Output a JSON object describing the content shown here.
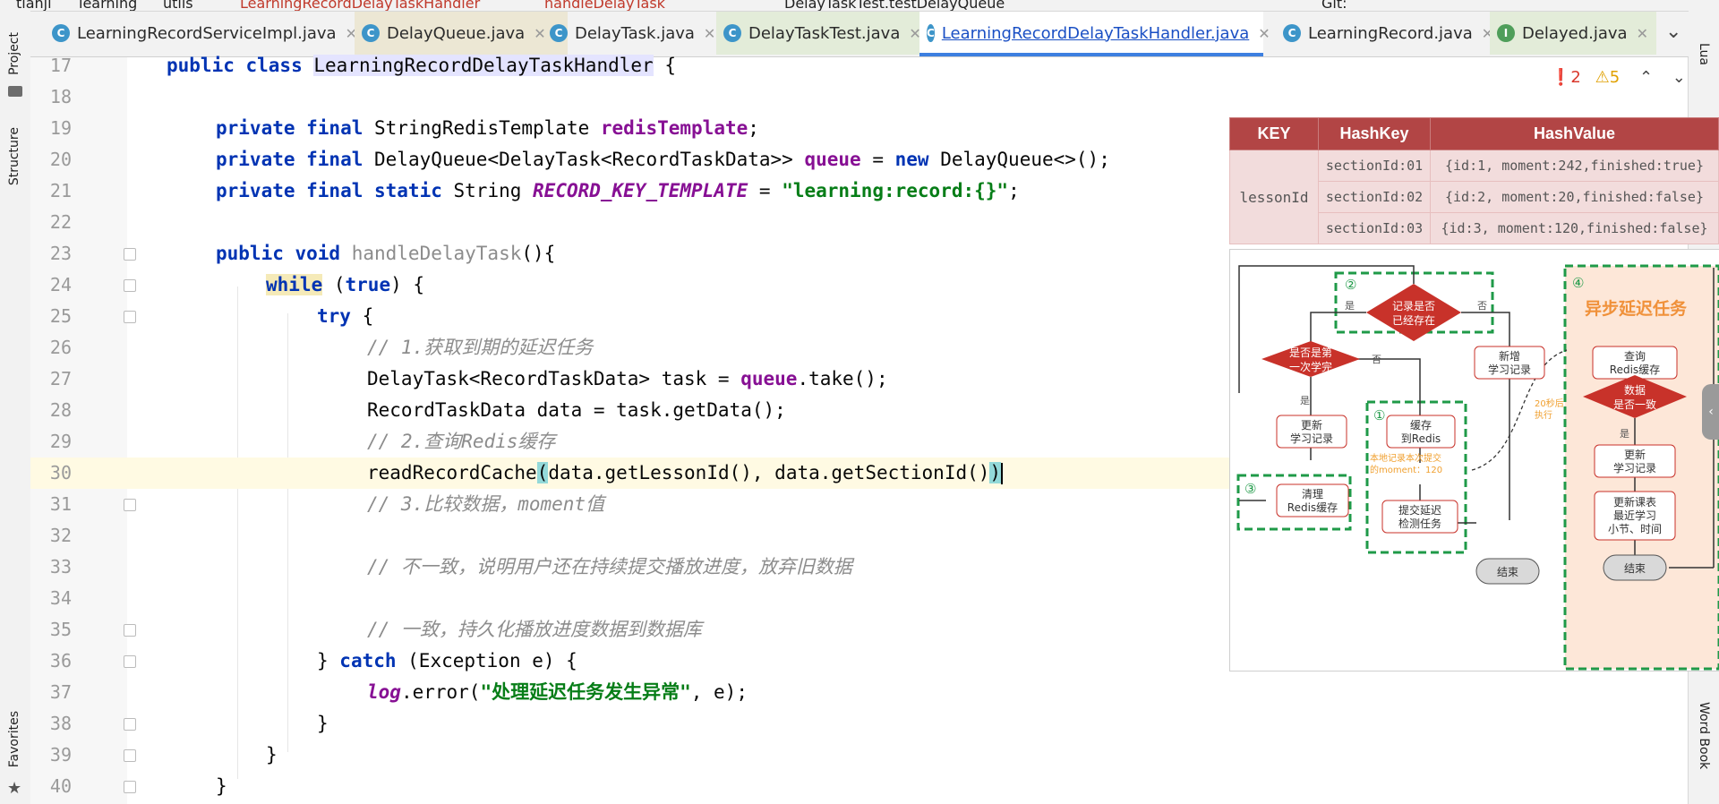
{
  "breadcrumb": [
    "tianji",
    "learning",
    "utils",
    "LearningRecordDelayTaskHandler",
    "handleDelayTask"
  ],
  "run_config": "DelayTaskTest.testDelayQueue",
  "git_label": "Git:",
  "sidebar_left": {
    "project": "Project",
    "structure": "Structure",
    "favorites": "Favorites"
  },
  "sidebar_right": {
    "top": "Lua",
    "word_book": "Word Book"
  },
  "tabs": [
    {
      "label": "LearningRecordServiceImpl.java",
      "icon": "C"
    },
    {
      "label": "DelayQueue.java",
      "icon": "C"
    },
    {
      "label": "DelayTask.java",
      "icon": "C"
    },
    {
      "label": "DelayTaskTest.java",
      "icon": "C"
    },
    {
      "label": "LearningRecordDelayTaskHandler.java",
      "icon": "C"
    },
    {
      "label": "LearningRecord.java",
      "icon": "C"
    },
    {
      "label": "Delayed.java",
      "icon": "I"
    }
  ],
  "inspections": {
    "errors": "2",
    "warnings": "5"
  },
  "line_numbers": [
    "17",
    "18",
    "19",
    "20",
    "21",
    "22",
    "23",
    "24",
    "25",
    "26",
    "27",
    "28",
    "29",
    "30",
    "31",
    "32",
    "33",
    "34",
    "35",
    "36",
    "37",
    "38",
    "39",
    "40"
  ],
  "code": {
    "l17": {
      "kw": "public class ",
      "cls": "LearningRecordDelayTaskHandler",
      "rest": " {"
    },
    "l19": {
      "kw": "private final ",
      "type": "StringRedisTemplate ",
      "field": "redisTemplate",
      "rest": ";"
    },
    "l20": {
      "kw": "private final ",
      "type": "DelayQueue<DelayTask<RecordTaskData>> ",
      "field": "queue",
      "eq": " = ",
      "kw2": "new ",
      "rest": "DelayQueue<>();"
    },
    "l21": {
      "kw": "private final static ",
      "type": "String ",
      "const": "RECORD_KEY_TEMPLATE",
      "eq": " = ",
      "str": "\"learning:record:{}\"",
      "rest": ";"
    },
    "l23": {
      "kw": "public void ",
      "method": "handleDelayTask",
      "rest": "(){"
    },
    "l24": {
      "kw": "while",
      "p1": " (",
      "kw2": "true",
      "p2": ") {"
    },
    "l25": {
      "kw": "try",
      "rest": " {"
    },
    "l26": "// 1.获取到期的延迟任务",
    "l27": {
      "a": "DelayTask<RecordTaskData> task = ",
      "field": "queue",
      "b": ".take();"
    },
    "l28": "RecordTaskData data = task.getData();",
    "l29": "// 2.查询Redis缓存",
    "l30": {
      "a": "readRecordCache",
      "b": "(",
      "c": "data.getLessonId(), data.getSectionId()",
      "d": ")"
    },
    "l31": "// 3.比较数据，moment值",
    "l33": "// 不一致，说明用户还在持续提交播放进度，放弃旧数据",
    "l35": "// 一致，持久化播放进度数据到数据库",
    "l36": {
      "a": "} ",
      "kw": "catch",
      "b": " (Exception e) {"
    },
    "l37": {
      "field": "log",
      "a": ".error(",
      "str": "\"处理延迟任务发生异常\"",
      "b": ", e);"
    },
    "l38": "}",
    "l39": "}",
    "l40": "}"
  },
  "redis_table": {
    "headers": [
      "KEY",
      "HashKey",
      "HashValue"
    ],
    "key": "lessonId",
    "rows": [
      {
        "hashkey": "sectionId:01",
        "value": "{id:1, moment:242,finished:true}"
      },
      {
        "hashkey": "sectionId:02",
        "value": "{id:2, moment:20,finished:false}"
      },
      {
        "hashkey": "sectionId:03",
        "value": "{id:3, moment:120,finished:false}"
      }
    ]
  },
  "flowchart": {
    "async_title": "异步延迟任务",
    "num1": "①",
    "num2": "②",
    "num3": "③",
    "num4": "④",
    "d1": [
      "记录是否",
      "已经存在"
    ],
    "d2": [
      "是否是第",
      "一次学完"
    ],
    "d3": [
      "数据",
      "是否一致"
    ],
    "yes": "是",
    "no": "否",
    "new_record": [
      "新增",
      "学习记录"
    ],
    "update_record": [
      "更新",
      "学习记录"
    ],
    "cache_redis": [
      "缓存",
      "到Redis"
    ],
    "clear_redis": [
      "清理",
      "Redis缓存"
    ],
    "submit_task": [
      "提交延迟",
      "检测任务"
    ],
    "local_note": [
      "本地记录本次提交",
      "的moment：120"
    ],
    "query_redis": [
      "查询",
      "Redis缓存"
    ],
    "update_record2": [
      "更新",
      "学习记录"
    ],
    "update_course": [
      "更新课表",
      "最近学习",
      "小节、时间"
    ],
    "end": "结束",
    "delay_note": [
      "20秒后",
      "执行"
    ]
  },
  "colors": {
    "keyword": "#0033b3",
    "field": "#871094",
    "string": "#067d17",
    "comment": "#8c8c8c",
    "diamond": "#c8322a",
    "dashed": "#1f9a48",
    "async_bg": "#fde7d8"
  }
}
